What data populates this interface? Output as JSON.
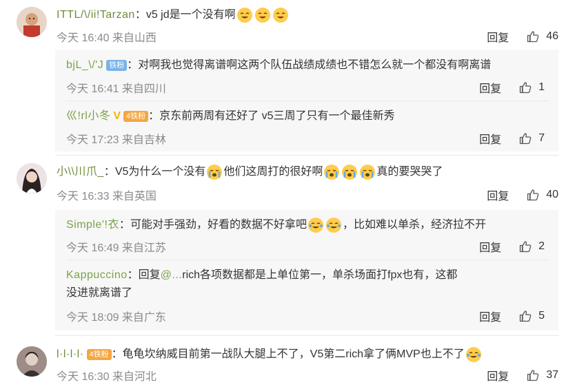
{
  "comments": [
    {
      "name": "ITTL/\\/ii!Tarzan",
      "separator": "：",
      "text_a": "v5 jd是一个没有啊",
      "emojis": 3,
      "time": "今天 16:40 来自山西",
      "reply": "回复",
      "likes": "46",
      "replies": [
        {
          "name": "bjL_\\/'J",
          "badge": "铁粉",
          "separator": "：",
          "text": "对啊我也觉得离谱啊这两个队伍战绩成绩也不错怎么就一个都没有啊离谱",
          "time": "今天 16:41 来自四川",
          "reply": "回复",
          "likes": "1"
        },
        {
          "name": "巛!rl小冬",
          "badge": "铁粉",
          "badge_level": "4",
          "separator": "：",
          "text": "京东前两周有还好了 v5三周了只有一个最佳新秀",
          "time": "今天 17:23 来自吉林",
          "reply": "回复",
          "likes": "7"
        }
      ]
    },
    {
      "name": "小\\\\川爪_",
      "separator": "：",
      "text_a": "V5为什么一个没有",
      "text_b": "他们这周打的很好啊",
      "text_c": "真的要哭哭了",
      "time": "今天 16:33 来自英国",
      "reply": "回复",
      "likes": "40",
      "replies": [
        {
          "name": "Simple'!衣",
          "separator": "：",
          "text_a": "可能对手强劲，好看的数据不好拿吧",
          "text_b": "，比如难以单杀，经济拉不开",
          "time": "今天 16:49 来自江苏",
          "reply": "回复",
          "likes": "2"
        },
        {
          "name": "Kappuccino",
          "separator": "：",
          "reply_prefix": "回复",
          "mention": "@...",
          "text_line1": "rich各项数据都是上单位第一，单杀场面打fpx也有，这都",
          "text_line2": "没进就离谱了",
          "time": "今天 18:09 来自广东",
          "reply": "回复",
          "likes": "5"
        }
      ]
    },
    {
      "name": "l·l·l·l·",
      "badge": "铁粉",
      "badge_level": "4",
      "separator": "：",
      "text": "龟龟坎纳威目前第一战队大腿上不了，V5第二rich拿了俩MVP也上不了",
      "time": "今天 16:30 来自河北",
      "reply": "回复",
      "likes": "37"
    }
  ],
  "colors": {
    "name": "#6f8a3a",
    "meta": "#8a8a8a",
    "subbox": "#f7f7f7",
    "fan_blue": "#7ab2e8",
    "fan_orange": "#f4a63f"
  }
}
